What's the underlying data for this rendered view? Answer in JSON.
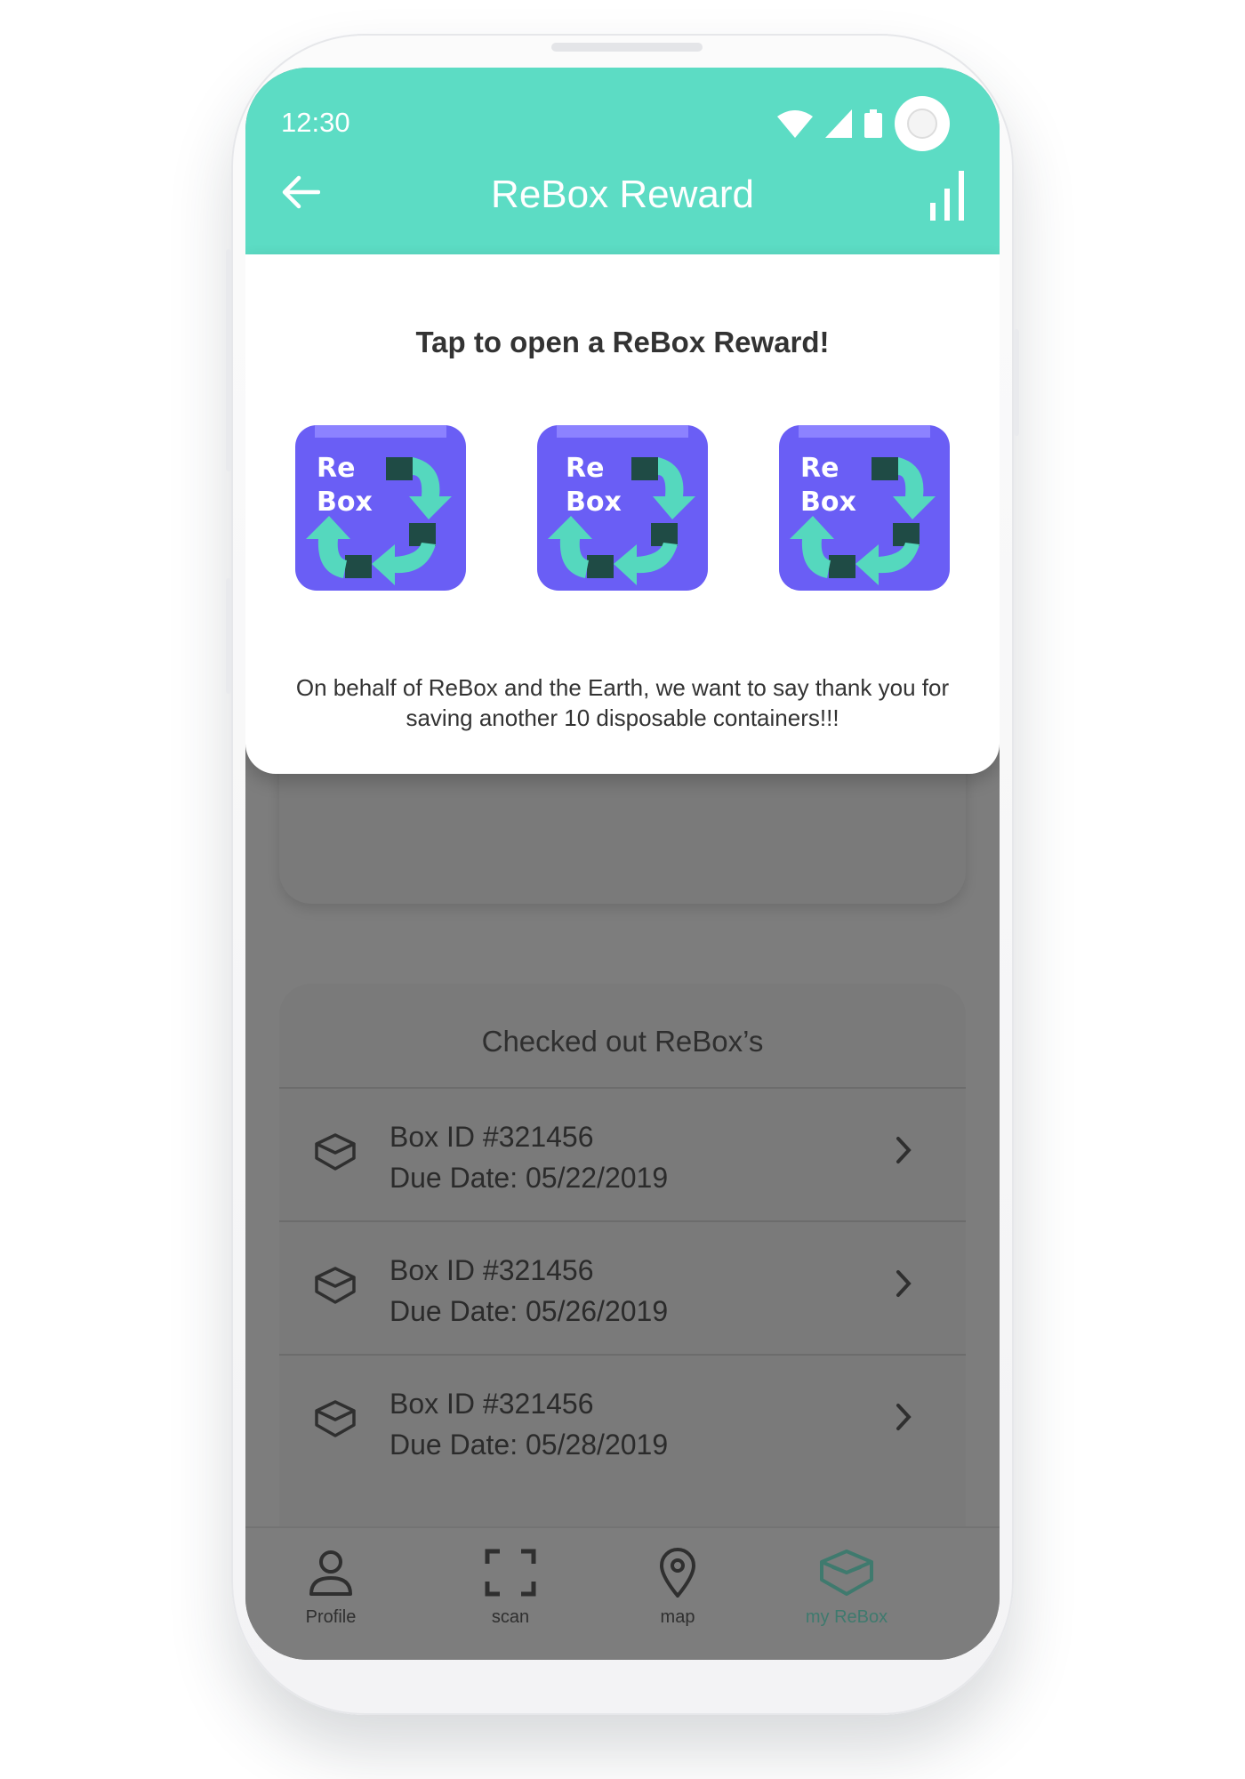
{
  "status_bar": {
    "time": "12:30"
  },
  "header": {
    "title": "ReBox Reward"
  },
  "reward_modal": {
    "heading": "Tap to open a ReBox Reward!",
    "box_logo_text": [
      "Re",
      "Box"
    ],
    "message": "On behalf of ReBox and the Earth, we want to say thank you for saving another 10 disposable containers!!!"
  },
  "checked_out": {
    "title": "Checked out ReBox’s",
    "items": [
      {
        "box_id": "Box ID #321456",
        "due": "Due Date: 05/22/2019"
      },
      {
        "box_id": "Box ID #321456",
        "due": "Due Date: 05/26/2019"
      },
      {
        "box_id": "Box ID #321456",
        "due": "Due Date: 05/28/2019"
      }
    ]
  },
  "bottom_nav": [
    {
      "label": "Profile",
      "icon": "person-icon"
    },
    {
      "label": "scan",
      "icon": "scan-icon"
    },
    {
      "label": "map",
      "icon": "map-pin-icon"
    },
    {
      "label": "my ReBox",
      "icon": "box-icon",
      "active": true
    }
  ],
  "colors": {
    "accent": "#5cdcc4",
    "reward_box": "#6a5ef5",
    "arrows": "#55d8be"
  }
}
